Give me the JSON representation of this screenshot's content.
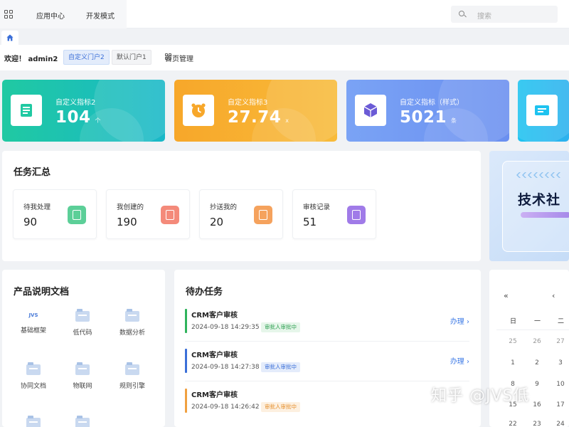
{
  "topnav": {
    "items": [
      "应用中心",
      "开发模式"
    ],
    "search_placeholder": "搜索"
  },
  "portal": {
    "welcome": "欢迎！ admin2",
    "chips": [
      "自定义门户2",
      "默认门户1"
    ],
    "home_manage": "首页管理"
  },
  "metrics": [
    {
      "label": "自定义指标2",
      "value": "104",
      "unit": "个",
      "color": "#20c9a2"
    },
    {
      "label": "自定义指标3",
      "value": "27.74",
      "unit": "x",
      "color": "#f7a72a"
    },
    {
      "label": "自定义指标（样式）",
      "value": "5021",
      "unit": "条",
      "color": "#7aa3f5"
    }
  ],
  "task_summary": {
    "title": "任务汇总",
    "stats": [
      {
        "label": "待我处理",
        "value": "90",
        "icon": "document-icon",
        "color": "#5ccf98"
      },
      {
        "label": "我创建的",
        "value": "190",
        "icon": "form-icon",
        "color": "#f48a7a"
      },
      {
        "label": "抄送我的",
        "value": "20",
        "icon": "cc-icon",
        "color": "#f5a25d"
      },
      {
        "label": "审核记录",
        "value": "51",
        "icon": "audit-icon",
        "color": "#a07be8"
      }
    ]
  },
  "banner": {
    "title": "技术社"
  },
  "docs": {
    "title": "产品说明文档",
    "items": [
      "基础框架",
      "低代码",
      "数据分析",
      "协同文档",
      "物联网",
      "规则引擎"
    ],
    "jvs_badge": "JVS"
  },
  "todo": {
    "title": "待办任务",
    "link_label": "办理",
    "items": [
      {
        "name": "CRM客户审核",
        "time": "2024-09-18 14:29:35",
        "status": "审批人审批中",
        "color": "#2fb35c",
        "tag_bg": "#e6f6ea",
        "tag_fg": "#2fa052"
      },
      {
        "name": "CRM客户审核",
        "time": "2024-09-18 14:27:38",
        "status": "审批人审批中",
        "color": "#3b6fd8",
        "tag_bg": "#e4ecfb",
        "tag_fg": "#3b6fd8"
      },
      {
        "name": "CRM客户审核",
        "time": "2024-09-18 14:26:42",
        "status": "审批人审批中",
        "color": "#f0a040",
        "tag_bg": "#fdf0e0",
        "tag_fg": "#e5902e"
      }
    ]
  },
  "calendar": {
    "prev_year": "«",
    "prev_month": "‹",
    "weekdays": [
      "日",
      "一",
      "二"
    ],
    "weeks": [
      [
        "25",
        "26",
        "27"
      ],
      [
        "1",
        "2",
        "3"
      ],
      [
        "8",
        "9",
        "10"
      ],
      [
        "15",
        "16",
        "17"
      ],
      [
        "22",
        "23",
        "24"
      ]
    ]
  },
  "watermark": "知乎 @JVS低"
}
